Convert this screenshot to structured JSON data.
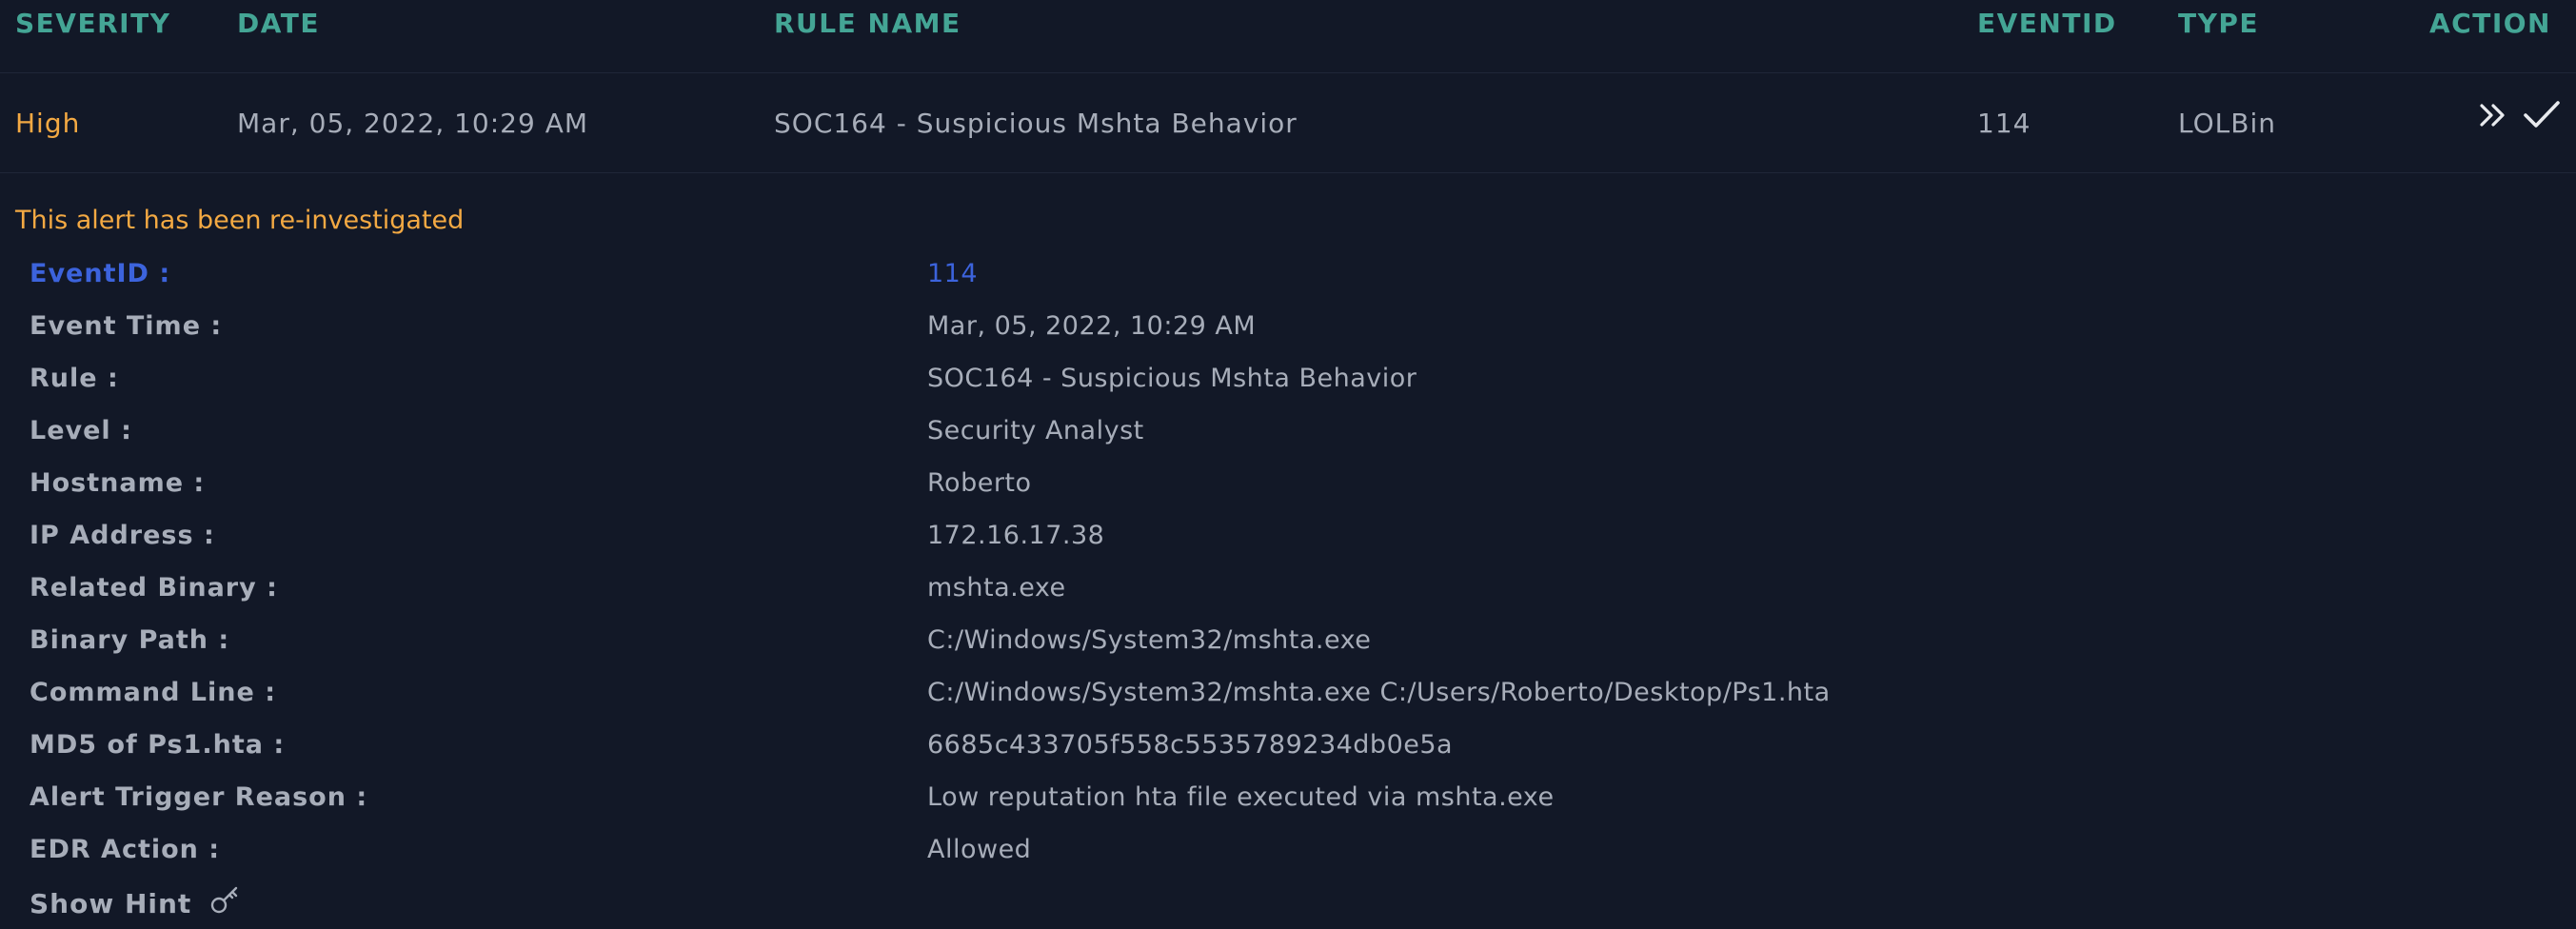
{
  "table": {
    "headers": {
      "severity": "SEVERITY",
      "date": "DATE",
      "rule_name": "RULE NAME",
      "eventid": "EVENTID",
      "type": "TYPE",
      "action": "ACTION"
    },
    "row": {
      "severity": "High",
      "date": "Mar, 05, 2022, 10:29 AM",
      "rule_name": "SOC164 - Suspicious Mshta Behavior",
      "eventid": "114",
      "type": "LOLBin",
      "actions": [
        "double-chevron-right-icon",
        "checkmark-icon"
      ]
    }
  },
  "notice": "This alert has been re-investigated",
  "details": [
    {
      "label": "EventID :",
      "value": "114"
    },
    {
      "label": "Event Time :",
      "value": "Mar, 05, 2022, 10:29 AM"
    },
    {
      "label": "Rule :",
      "value": "SOC164 - Suspicious Mshta Behavior"
    },
    {
      "label": "Level :",
      "value": "Security Analyst"
    },
    {
      "label": "Hostname :",
      "value": "Roberto"
    },
    {
      "label": "IP Address :",
      "value": "172.16.17.38"
    },
    {
      "label": "Related Binary :",
      "value": "mshta.exe"
    },
    {
      "label": "Binary Path :",
      "value": "C:/Windows/System32/mshta.exe"
    },
    {
      "label": "Command Line :",
      "value": "C:/Windows/System32/mshta.exe C:/Users/Roberto/Desktop/Ps1.hta"
    },
    {
      "label": "MD5 of Ps1.hta :",
      "value": "6685c433705f558c5535789234db0e5a"
    },
    {
      "label": "Alert Trigger Reason :",
      "value": "Low reputation hta file executed via mshta.exe"
    },
    {
      "label": "EDR Action :",
      "value": "Allowed"
    }
  ],
  "hint": {
    "label": "Show Hint",
    "icon": "key-icon"
  },
  "colors": {
    "background": "#121827",
    "header_text": "#44a595",
    "severity_high": "#f3a943",
    "link_blue": "#3c63dc",
    "text": "#a7adb9"
  }
}
